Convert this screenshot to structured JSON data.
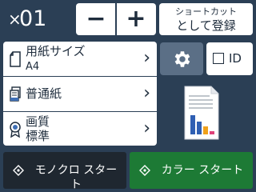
{
  "copies": {
    "prefix": "×",
    "value": "01"
  },
  "stepper": {
    "minus_label": "−",
    "plus_label": "+"
  },
  "shortcut": {
    "line1": "ショートカット",
    "line2": "として登録"
  },
  "settings": [
    {
      "label": "用紙サイズ",
      "value": "A4",
      "icon": "paper-size-icon"
    },
    {
      "label": "普通紙",
      "value": "",
      "icon": "paper-type-icon"
    },
    {
      "label": "画質",
      "value": "標準",
      "icon": "quality-icon"
    }
  ],
  "id_option": {
    "label": "ID",
    "checked": false
  },
  "start": {
    "mono_label": "モノクロ スタート",
    "color_label": "カラー スタート"
  },
  "colors": {
    "background": "#2b3f55",
    "mono_button": "#1f2730",
    "color_button": "#1d7a35",
    "gear_button": "#5b6f86",
    "panel": "#ffffff"
  }
}
